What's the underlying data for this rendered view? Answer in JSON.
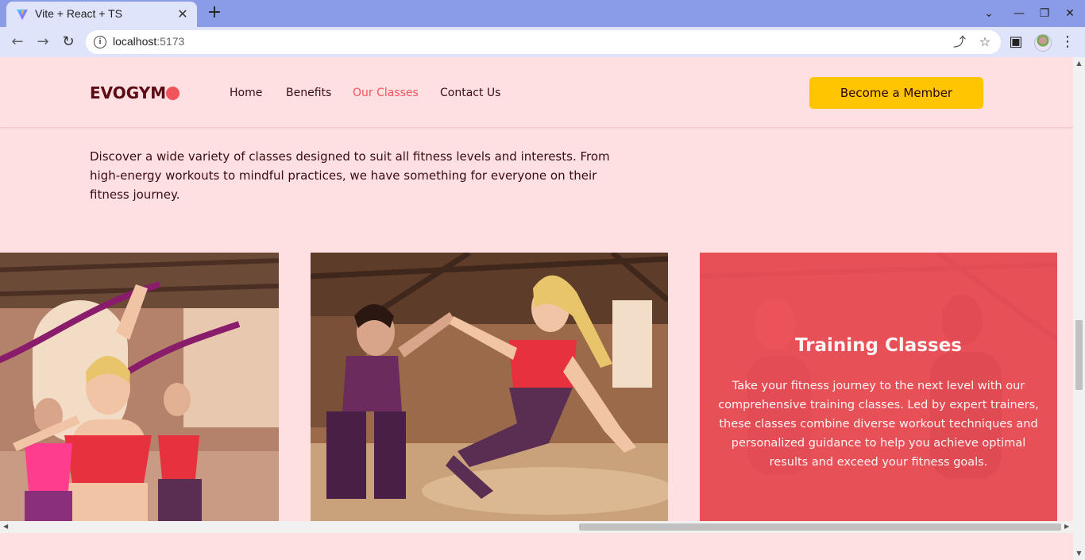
{
  "browser": {
    "tab_title": "Vite + React + TS",
    "close_tab": "✕",
    "new_tab": "+",
    "url_host": "localhost",
    "url_port": ":5173",
    "controls": {
      "chevron": "⌄",
      "minimize": "—",
      "restore": "❐",
      "close": "✕"
    },
    "nav": {
      "back": "←",
      "forward": "→",
      "reload": "↻"
    },
    "omni_icons": {
      "share": "⤴",
      "star": "☆",
      "sidepanel": "▣",
      "menu": "⋮"
    }
  },
  "navbar": {
    "logo": "EVOGYM",
    "links": [
      {
        "label": "Home",
        "active": false
      },
      {
        "label": "Benefits",
        "active": false
      },
      {
        "label": "Our Classes",
        "active": true
      },
      {
        "label": "Contact Us",
        "active": false
      }
    ],
    "cta_label": "Become a Member"
  },
  "classes": {
    "intro": "Discover a wide variety of classes designed to suit all fitness levels and interests. From high-energy workouts to mindful practices, we have something for everyone on their fitness journey.",
    "cards": [
      {
        "image": "fitness-class-photo-resistance-bands"
      },
      {
        "image": "fitness-class-photo-high-five"
      },
      {
        "title": "Training Classes",
        "description": "Take your fitness journey to the next level with our comprehensive training classes. Led by expert trainers, these classes combine diverse workout techniques and personalized guidance to help you achieve optimal results and exceed your fitness goals."
      }
    ]
  },
  "colors": {
    "page_bg": "#ffe0e2",
    "primary": "#f2545b",
    "secondary": "#ffc500",
    "text_dark": "#5c0b13"
  }
}
